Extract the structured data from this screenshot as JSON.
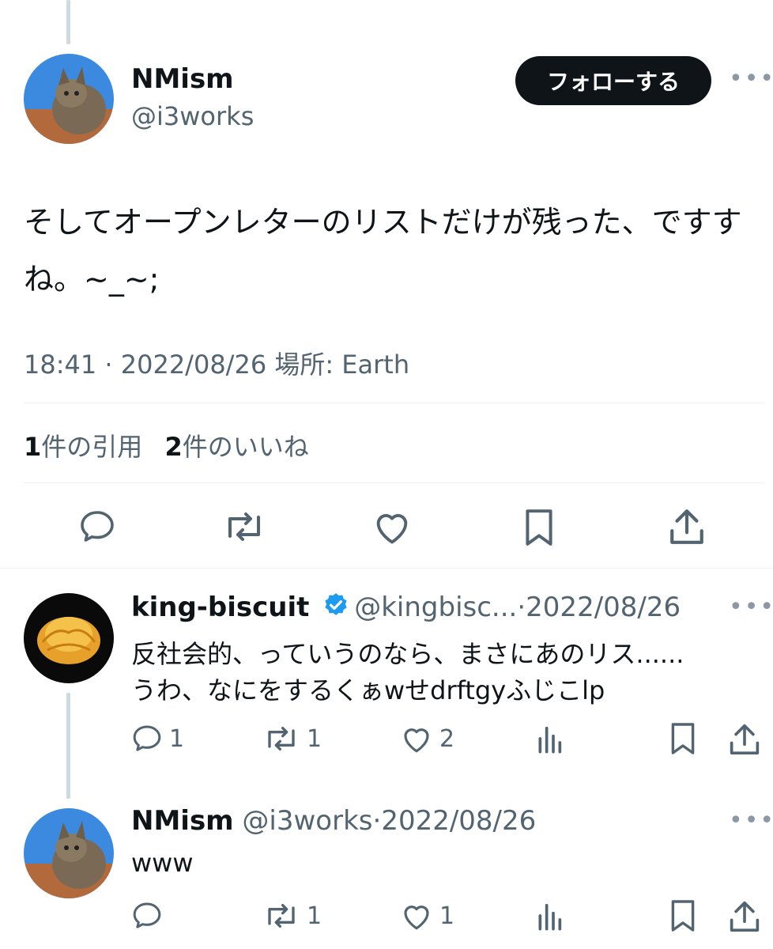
{
  "main_tweet": {
    "author_name": "NMism",
    "author_handle": "@i3works",
    "follow_label": "フォローする",
    "text_line1": "そしてオープンレターのリストだけが残った、ですす",
    "text_line2": "ね。~_~;",
    "time": "18:41",
    "date": "2022/08/26",
    "location": "場所: Earth",
    "quote_count": "1",
    "quote_label": "件の引用",
    "like_count": "2",
    "like_label": "件のいいね"
  },
  "replies": [
    {
      "author_name": "king-biscuit",
      "author_handle": "@kingbisc...",
      "date": "2022/08/26",
      "text_line1": "反社会的、っていうのなら、まさにあのリス......",
      "text_line2": "うわ、なにをするくぁwせdrftgyふじこlp",
      "reply_count": "1",
      "retweet_count": "1",
      "like_count": "2"
    },
    {
      "author_name": "NMism",
      "author_handle": "@i3works",
      "date": "2022/08/26",
      "text_line1": "www",
      "reply_count": "",
      "retweet_count": "1",
      "like_count": "1"
    }
  ],
  "separator": "·",
  "colors": {
    "text": "#0f1419",
    "muted": "#536471",
    "verified": "#1d9bf0",
    "line": "#cfd9de"
  },
  "icons": [
    "reply-icon",
    "retweet-icon",
    "like-icon",
    "bookmark-icon",
    "share-icon",
    "views-icon",
    "more-icon",
    "verified-badge-icon"
  ]
}
